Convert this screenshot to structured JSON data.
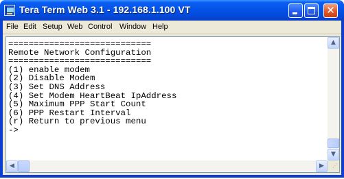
{
  "window": {
    "title": "Tera Term Web 3.1 - 192.168.1.100 VT",
    "icons": {
      "app": "terminal-app-icon",
      "minimize": "minimize-icon",
      "maximize": "maximize-icon",
      "close": "close-icon"
    },
    "close_glyph": "✕"
  },
  "menubar": {
    "items": [
      "File",
      "Edit",
      "Setup",
      "Web",
      "Control",
      "Window",
      "Help"
    ]
  },
  "terminal": {
    "lines": [
      "============================",
      "Remote Network Configuration",
      "============================",
      "(1) enable modem",
      "(2) Disable Modem",
      "(3) Set DNS Address",
      "(4) Set Modem HeartBeat IpAddress",
      "(5) Maximum PPP Start Count",
      "(6) PPP Restart Interval",
      "(r) Return to previous menu",
      "->"
    ]
  },
  "scrollbars": {
    "up_arrow": "▲",
    "down_arrow": "▼",
    "left_arrow": "◀",
    "right_arrow": "▶",
    "grip": "⋰"
  },
  "colors": {
    "titlebar": "#0452e6",
    "window_border": "#0a3fd1",
    "close_button": "#e05a2c",
    "terminal_bg": "#ffffff",
    "terminal_text": "#000000"
  }
}
